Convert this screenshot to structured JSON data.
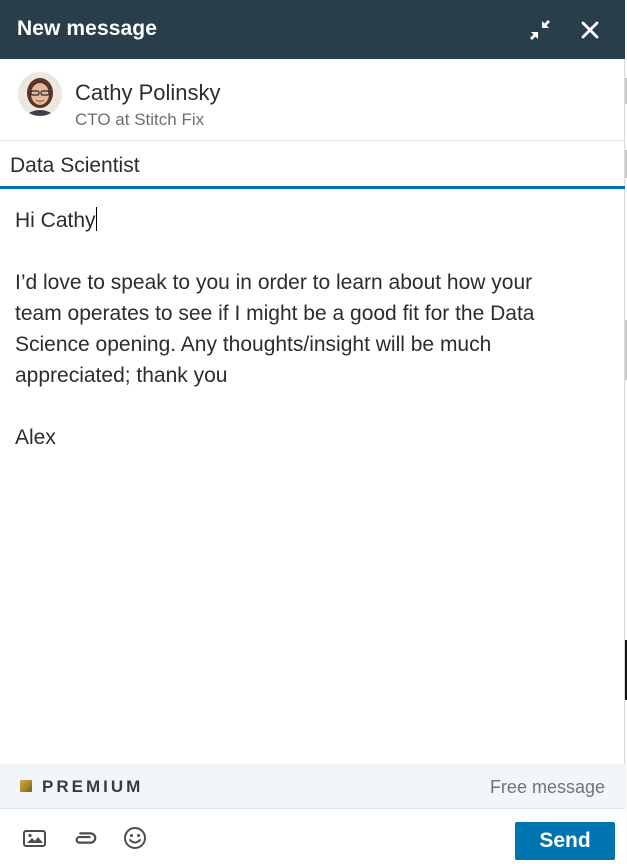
{
  "header": {
    "title": "New message"
  },
  "recipient": {
    "name": "Cathy Polinsky",
    "title": "CTO at Stitch Fix"
  },
  "subject": {
    "value": "Data Scientist"
  },
  "message": {
    "greeting": "Hi Cathy",
    "body": "\n\nI’d love to speak to you in order to learn about how your team operates to see if I might be a good fit for the Data Science opening. Any thoughts/insight will be much appreciated; thank you\n\nAlex"
  },
  "premium": {
    "label": "PREMIUM",
    "free_text": "Free message"
  },
  "footer": {
    "send_label": "Send"
  },
  "icons": {
    "minimize": "minimize-arrows-icon",
    "close": "close-icon",
    "image": "image-icon",
    "attach": "paperclip-icon",
    "emoji": "emoji-icon"
  },
  "colors": {
    "header_bg": "#283e4a",
    "accent": "#0073b1",
    "premium_gold": "#b8952f"
  }
}
